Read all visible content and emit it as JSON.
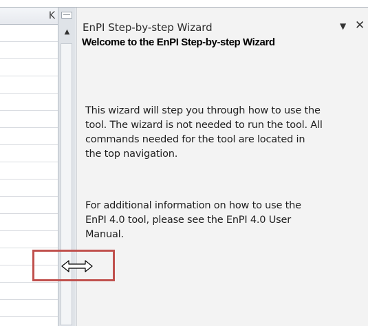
{
  "sheet": {
    "column_header": "K"
  },
  "pane": {
    "title": "EnPI Step-by-step Wizard",
    "dropdown_icon": "▼",
    "close_icon": "✕",
    "heading": "Welcome to the EnPI Step-by-step Wizard",
    "paragraph1": "This wizard will step you through how to use the tool. The wizard is not needed to run the tool. All commands needed for the tool are located in the top navigation.",
    "paragraph2": "For additional information on how to use the EnPI 4.0 tool, please see the EnPI 4.0 User Manual."
  },
  "scrollbar": {
    "up_arrow": "▲"
  },
  "colors": {
    "highlight": "#c0504d",
    "pane_background": "#f3f3f3"
  }
}
